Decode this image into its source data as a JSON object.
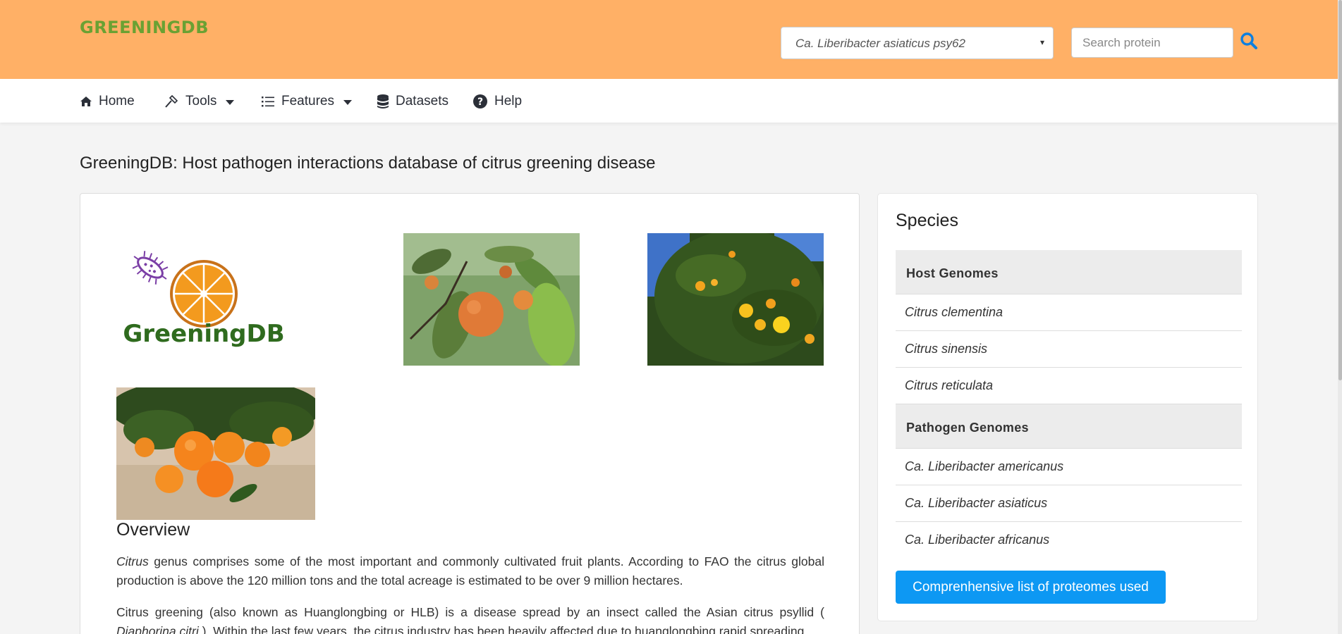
{
  "header": {
    "brand": "GREENINGDB",
    "species_select_value": "Ca. Liberibacter asiaticus psy62",
    "search_placeholder": "Search protein"
  },
  "nav": {
    "items": [
      {
        "label": "Home",
        "icon": "home-icon"
      },
      {
        "label": "Tools",
        "icon": "hammer-icon",
        "dropdown": true
      },
      {
        "label": "Features",
        "icon": "list-icon",
        "dropdown": true
      },
      {
        "label": "Datasets",
        "icon": "database-icon"
      },
      {
        "label": "Help",
        "icon": "question-circle-icon"
      }
    ]
  },
  "main": {
    "page_title": "GreeningDB: Host pathogen interactions database of citrus greening disease",
    "logo_text": "GreeningDB",
    "overview_title": "Overview",
    "para1_em": "Citrus",
    "para1_rest": " genus comprises some of the most important and commonly cultivated fruit plants. According to FAO the citrus global production is above the 120 million tons and the total acreage is estimated to be over 9 million hectares.",
    "para2_start": "Citrus greening (also known as Huanglongbing or HLB) is a disease spread by an insect called the Asian citrus psyllid ( ",
    "para2_em": "Diaphorina citri",
    "para2_rest": " ). Within the last few years, the citrus industry has been heavily affected due to huanglongbing rapid spreading"
  },
  "sidebar": {
    "title": "Species",
    "host_header": "Host Genomes",
    "host_items": [
      "Citrus clementina",
      "Citrus sinensis",
      "Citrus reticulata"
    ],
    "pathogen_header": "Pathogen Genomes",
    "pathogen_items": [
      "Ca. Liberibacter americanus",
      "Ca. Liberibacter asiaticus",
      "Ca. Liberibacter africanus"
    ],
    "button_label": "Comprenhensive list of proteomes used"
  },
  "colors": {
    "header_bg": "#ffb066",
    "brand": "#6aa133",
    "accent": "#0d98f3",
    "logo_orange": "#f39a1e",
    "logo_green": "#2f6b1e",
    "logo_purple": "#7b3fa6"
  }
}
